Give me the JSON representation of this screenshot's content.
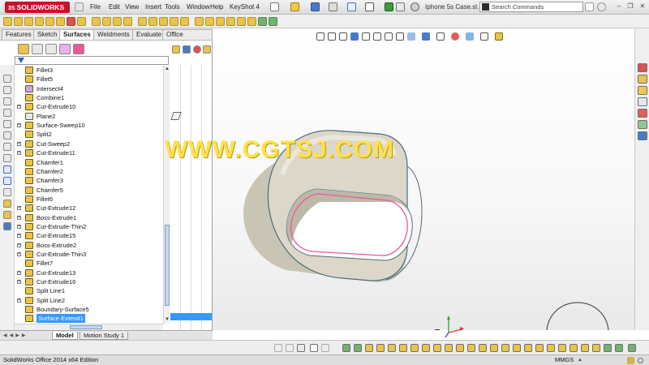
{
  "app": {
    "logo_text": "SOLIDWORKS",
    "logo_prefix": "3S"
  },
  "menu": [
    "File",
    "Edit",
    "View",
    "Insert",
    "Tools",
    "Window",
    "Help",
    "KeyShot 4"
  ],
  "document_title": "Iphone 5s Case.sl...",
  "search": {
    "placeholder": "Search Commands"
  },
  "window_controls": {
    "minimize": "–",
    "restore": "❐",
    "close": "✕"
  },
  "command_tabs": [
    "Features",
    "Sketch",
    "Surfaces",
    "Weldments",
    "Evaluate",
    "Office Products"
  ],
  "active_command_tab": "Surfaces",
  "feature_tree": [
    {
      "label": "Fillet3",
      "expandable": false,
      "icon_color": "#e9c34a"
    },
    {
      "label": "Fillet5",
      "expandable": false,
      "icon_color": "#e9c34a"
    },
    {
      "label": "Intersect4",
      "expandable": false,
      "icon_color": "#c9a3e8"
    },
    {
      "label": "Combine1",
      "expandable": false,
      "icon_color": "#e9c34a"
    },
    {
      "label": "Cut-Extrude10",
      "expandable": true,
      "icon_color": "#e9c34a"
    },
    {
      "label": "Plane2",
      "expandable": false,
      "icon_color": "#dfe8f5"
    },
    {
      "label": "Surface-Sweep10",
      "expandable": true,
      "icon_color": "#e9c34a"
    },
    {
      "label": "Split2",
      "expandable": false,
      "icon_color": "#e9c34a"
    },
    {
      "label": "Cut-Sweep2",
      "expandable": true,
      "icon_color": "#e9c34a"
    },
    {
      "label": "Cut-Extrude11",
      "expandable": true,
      "icon_color": "#e9c34a"
    },
    {
      "label": "Chamfer1",
      "expandable": false,
      "icon_color": "#e9c34a"
    },
    {
      "label": "Chamfer2",
      "expandable": false,
      "icon_color": "#e9c34a"
    },
    {
      "label": "Chamfer3",
      "expandable": false,
      "icon_color": "#e9c34a"
    },
    {
      "label": "Chamfer5",
      "expandable": false,
      "icon_color": "#e9c34a"
    },
    {
      "label": "Fillet6",
      "expandable": false,
      "icon_color": "#e9c34a"
    },
    {
      "label": "Cut-Extrude12",
      "expandable": true,
      "icon_color": "#e9c34a"
    },
    {
      "label": "Boss-Extrude1",
      "expandable": true,
      "icon_color": "#e9c34a"
    },
    {
      "label": "Cut-Extrude-Thin2",
      "expandable": true,
      "icon_color": "#e9c34a"
    },
    {
      "label": "Cut-Extrude15",
      "expandable": true,
      "icon_color": "#e9c34a"
    },
    {
      "label": "Boss-Extrude2",
      "expandable": true,
      "icon_color": "#e9c34a"
    },
    {
      "label": "Cut-Extrude-Thin3",
      "expandable": true,
      "icon_color": "#e9c34a"
    },
    {
      "label": "Fillet7",
      "expandable": false,
      "icon_color": "#e9c34a"
    },
    {
      "label": "Cut-Extrude13",
      "expandable": true,
      "icon_color": "#e9c34a"
    },
    {
      "label": "Cut-Extrude16",
      "expandable": true,
      "icon_color": "#e9c34a"
    },
    {
      "label": "Split Line1",
      "expandable": false,
      "icon_color": "#e9c34a"
    },
    {
      "label": "Split Line2",
      "expandable": true,
      "icon_color": "#e9c34a"
    },
    {
      "label": "Boundary-Surface5",
      "expandable": false,
      "icon_color": "#e9c34a"
    },
    {
      "label": "Surface-Extend1",
      "expandable": false,
      "icon_color": "#e9c34a",
      "selected": true
    }
  ],
  "bottom_tabs": [
    "Model",
    "Motion Study 1"
  ],
  "active_bottom_tab": "Model",
  "watermark": "WWW.CGTSJ.COM",
  "status": {
    "text": "SolidWorks Office 2014 x64 Edition",
    "units": "MMGS"
  },
  "colors": {
    "selection": "#3399ff",
    "part_outer": "#d8d3c4",
    "part_edge": "#4a6b7a",
    "split_line": "#e85a9a",
    "brand_red": "#c8102e",
    "watermark": "#ffe14a"
  }
}
